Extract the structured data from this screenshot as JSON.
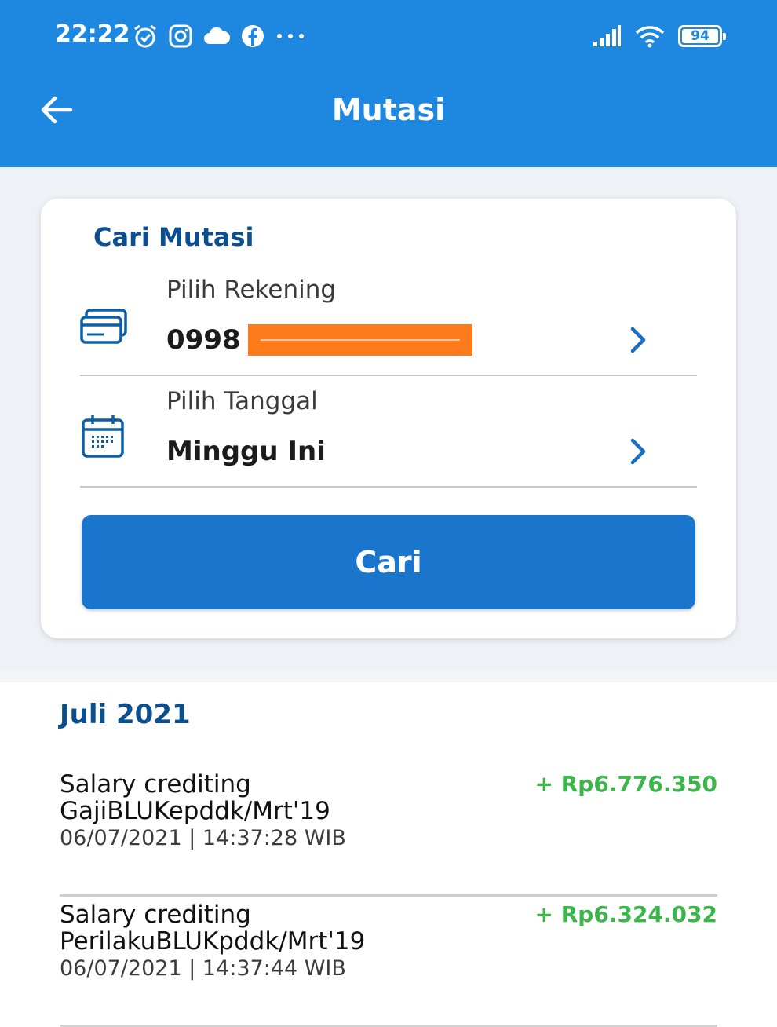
{
  "status_bar": {
    "time": "22:22",
    "left_icons": [
      "alarm-icon",
      "instagram-icon",
      "cloud-icon",
      "facebook-icon",
      "more-dots-icon"
    ],
    "right_icons": [
      "signal-icon",
      "wifi-icon",
      "battery-icon"
    ],
    "battery": "94"
  },
  "header": {
    "title": "Mutasi",
    "back_icon": "arrow-left-icon",
    "color": "#1e88e0"
  },
  "search_card": {
    "title": "Cari Mutasi",
    "account": {
      "label": "Pilih Rekening",
      "value": "0998 (",
      "icon": "card-icon"
    },
    "date": {
      "label": "Pilih Tanggal",
      "value": "Minggu Ini",
      "icon": "calendar-icon"
    },
    "button_label": "Cari"
  },
  "results": {
    "month": "Juli 2021",
    "transactions": [
      {
        "description": "Salary crediting\nGajiBLUKepddk/Mrt'19",
        "amount": "+ Rp6.776.350",
        "datetime": "06/07/2021 | 14:37:28 WIB"
      },
      {
        "description": "Salary crediting\nPerilakuBLUKpddk/Mrt'19",
        "amount": "+ Rp6.324.032",
        "datetime": "06/07/2021 | 14:37:44 WIB"
      }
    ]
  },
  "colors": {
    "primary": "#1e88e0",
    "button": "#1a75cc",
    "title_dark_blue": "#0b4f8f",
    "credit_green": "#3cb54a",
    "redaction_orange": "#ff7a1a"
  }
}
